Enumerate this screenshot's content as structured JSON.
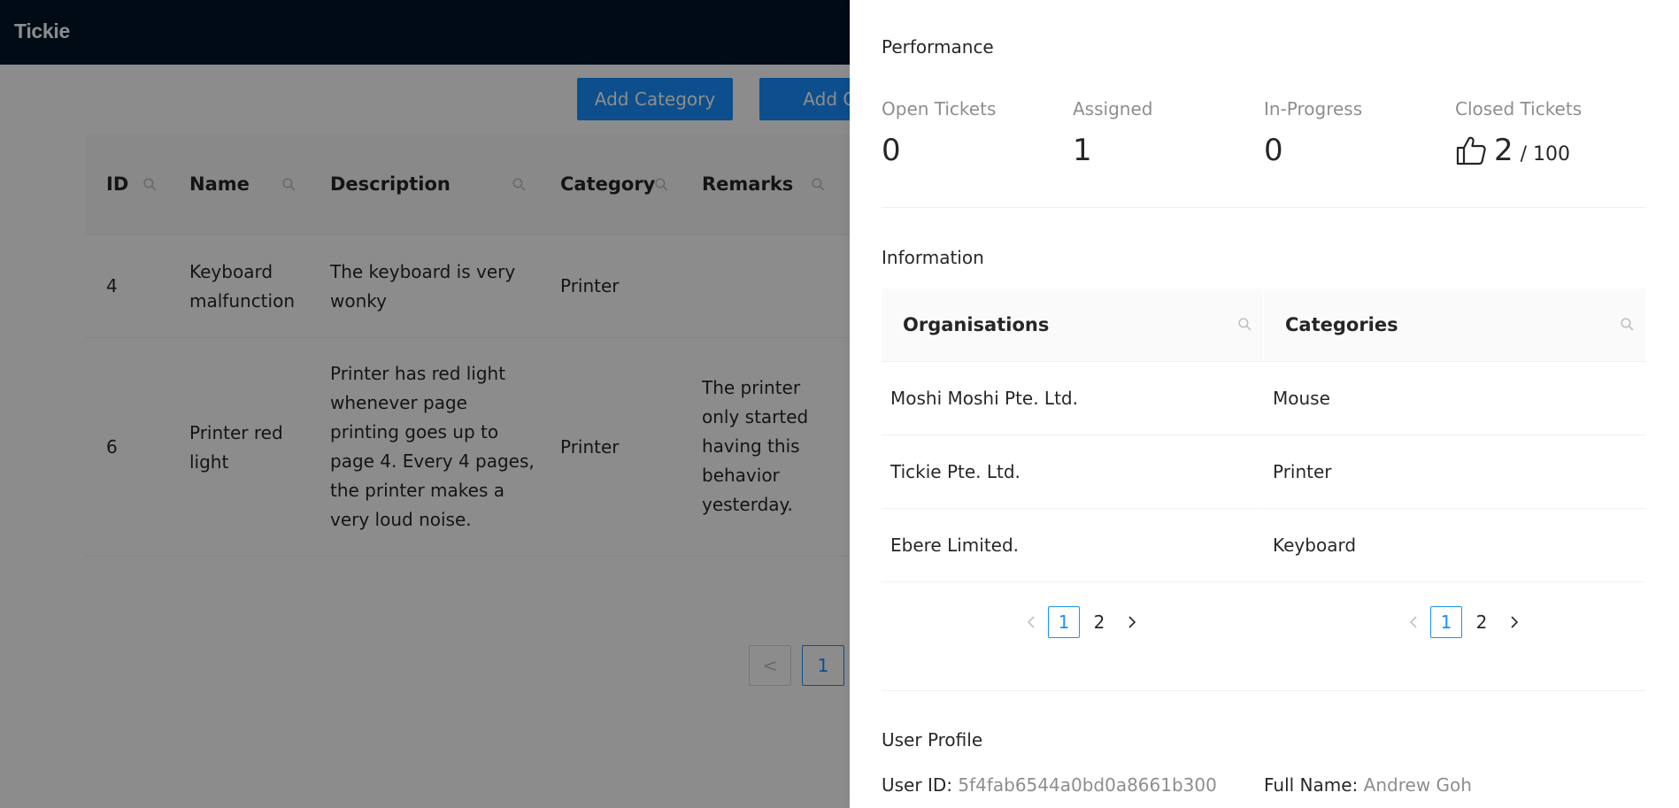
{
  "app": {
    "title": "Tickie"
  },
  "toolbar": {
    "add_category_label": "Add Category",
    "add_organisation_label": "Add Org"
  },
  "tickets_table": {
    "columns": [
      "ID",
      "Name",
      "Description",
      "Category",
      "Remarks"
    ],
    "rows": [
      {
        "id": "4",
        "name": [
          "Keyboard",
          "malfunction"
        ],
        "description": [
          "The keyboard is very",
          "wonky"
        ],
        "category": "Printer",
        "remarks": []
      },
      {
        "id": "6",
        "name": [
          "Printer red",
          "light"
        ],
        "description": [
          "Printer has red light",
          "whenever page",
          "printing goes up to",
          "page 4. Every 4 pages,",
          "the printer makes a",
          "very loud noise."
        ],
        "category": "Printer",
        "remarks": [
          "The printer",
          "only started",
          "having this",
          "behavior",
          "yesterday."
        ]
      }
    ],
    "pagination": {
      "prev_symbol": "<",
      "current_page": "1"
    }
  },
  "drawer": {
    "performance": {
      "title": "Performance",
      "stats": [
        {
          "label": "Open Tickets",
          "value": "0"
        },
        {
          "label": "Assigned",
          "value": "1"
        },
        {
          "label": "In-Progress",
          "value": "0"
        },
        {
          "label": "Closed Tickets",
          "value": "2",
          "suffix": "/ 100",
          "icon": "like-icon"
        }
      ]
    },
    "information": {
      "title": "Information",
      "organisations": {
        "header": "Organisations",
        "rows": [
          "Moshi Moshi Pte. Ltd.",
          "Tickie Pte. Ltd.",
          "Ebere Limited."
        ],
        "pages": [
          "1",
          "2"
        ],
        "current_page": "1"
      },
      "categories": {
        "header": "Categories",
        "rows": [
          "Mouse",
          "Printer",
          "Keyboard"
        ],
        "pages": [
          "1",
          "2"
        ],
        "current_page": "1"
      }
    },
    "user_profile": {
      "title": "User Profile",
      "user_id_label": "User ID:",
      "user_id": "5f4fab6544a0bd0a8661b300",
      "full_name_label": "Full Name:",
      "full_name": "Andrew Goh"
    }
  },
  "colors": {
    "primary": "#1890ff",
    "header_bg": "#001529",
    "overlay": "rgba(0,0,0,0.45)"
  }
}
